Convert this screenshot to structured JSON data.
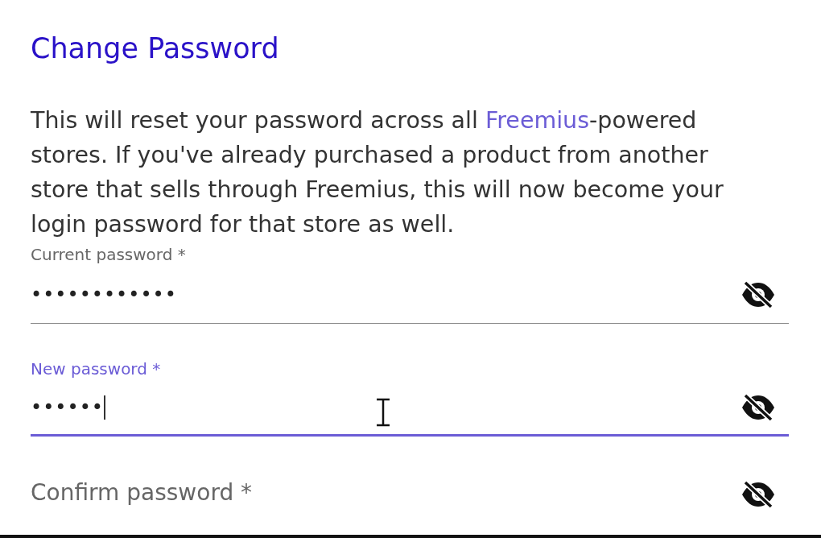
{
  "title": "Change Password",
  "intro": [
    {
      "kind": "text",
      "text": "This will reset your password across all "
    },
    {
      "kind": "link",
      "text": "Freemius"
    },
    {
      "kind": "text",
      "text": "-powered stores. If you've already purchased a product from another store that sells through Freemius, this will now become your login password for that store as well."
    }
  ],
  "fields": [
    {
      "label": "Current password *",
      "value": "••••••••••••",
      "focused": false,
      "masked": true
    },
    {
      "label": "New password *",
      "value": "••••••",
      "focused": true,
      "masked": true
    },
    {
      "label": "Confirm password *",
      "focused": false,
      "masked": true
    }
  ]
}
